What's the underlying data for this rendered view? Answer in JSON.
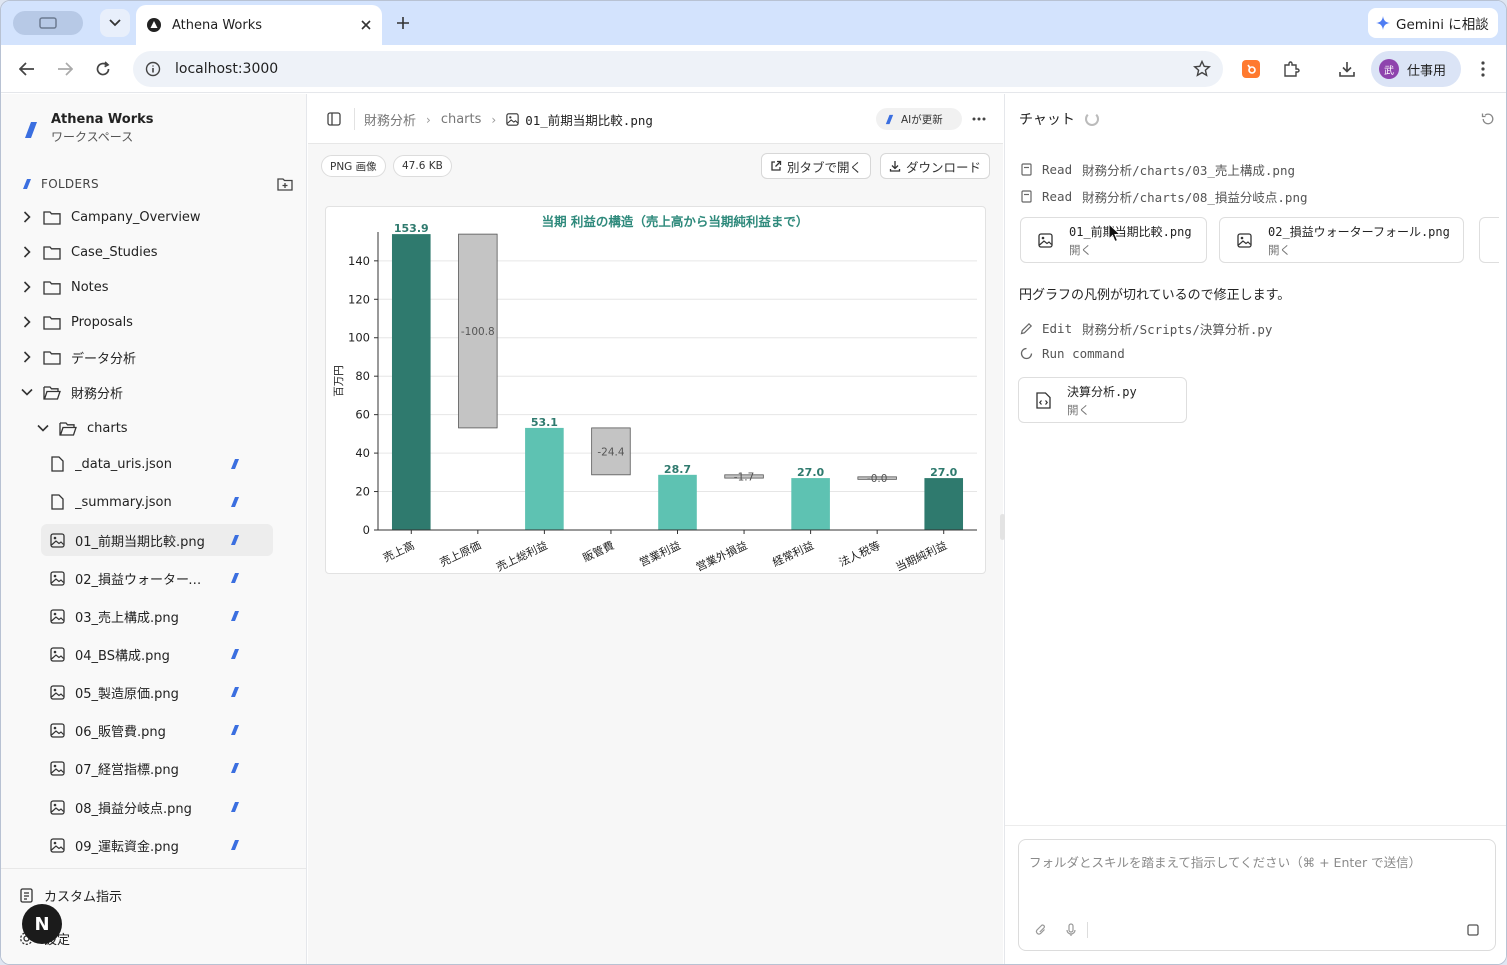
{
  "browser": {
    "tab_title": "Athena Works",
    "url": "localhost:3000",
    "gemini_label": "Gemini に相談",
    "profile_label": "仕事用",
    "profile_initial": "武"
  },
  "sidebar": {
    "brand_name": "Athena Works",
    "brand_sub": "ワークスペース",
    "folders_label": "FOLDERS",
    "folders": [
      {
        "label": "Campany_Overview"
      },
      {
        "label": "Case_Studies"
      },
      {
        "label": "Notes"
      },
      {
        "label": "Proposals"
      },
      {
        "label": "データ分析"
      },
      {
        "label": "財務分析"
      },
      {
        "label": "charts"
      }
    ],
    "files": [
      {
        "label": "_data_uris.json"
      },
      {
        "label": "_summary.json"
      },
      {
        "label": "01_前期当期比較.png"
      },
      {
        "label": "02_損益ウォーターフォール.png"
      },
      {
        "label": "03_売上構成.png"
      },
      {
        "label": "04_BS構成.png"
      },
      {
        "label": "05_製造原価.png"
      },
      {
        "label": "06_販管費.png"
      },
      {
        "label": "07_経営指標.png"
      },
      {
        "label": "08_損益分岐点.png"
      },
      {
        "label": "09_運転資金.png"
      }
    ],
    "custom_instructions": "カスタム指示",
    "settings": "設定",
    "badge": "N"
  },
  "viewer": {
    "breadcrumb": [
      "財務分析",
      "charts",
      "01_前期当期比較.png"
    ],
    "ai_updated": "AIが更新",
    "file_type": "PNG 画像",
    "file_size": "47.6 KB",
    "open_new_tab": "別タブで開く",
    "download": "ダウンロード"
  },
  "chart_data": {
    "type": "bar",
    "subtype": "waterfall",
    "title": "当期 利益の構造（売上高から当期純利益まで）",
    "ylabel": "百万円",
    "xlabel": "",
    "ylim": [
      0,
      155
    ],
    "yticks": [
      0,
      20,
      40,
      60,
      80,
      100,
      120,
      140
    ],
    "grid": true,
    "categories": [
      "売上高",
      "売上原価",
      "売上総利益",
      "販管費",
      "営業利益",
      "営業外損益",
      "経常利益",
      "法人税等",
      "当期純利益"
    ],
    "bars": [
      {
        "label": "153.9",
        "base": 0,
        "top": 153.9,
        "kind": "total"
      },
      {
        "label": "-100.8",
        "base": 53.1,
        "top": 153.9,
        "kind": "decrease"
      },
      {
        "label": "53.1",
        "base": 0,
        "top": 53.1,
        "kind": "subtotal"
      },
      {
        "label": "-24.4",
        "base": 28.7,
        "top": 53.1,
        "kind": "decrease"
      },
      {
        "label": "28.7",
        "base": 0,
        "top": 28.7,
        "kind": "subtotal"
      },
      {
        "label": "-1.7",
        "base": 27.0,
        "top": 28.7,
        "kind": "decrease"
      },
      {
        "label": "27.0",
        "base": 0,
        "top": 27.0,
        "kind": "subtotal"
      },
      {
        "label": "-0.0",
        "base": 27.0,
        "top": 27.0,
        "kind": "decrease"
      },
      {
        "label": "27.0",
        "base": 0,
        "top": 27.0,
        "kind": "total"
      }
    ],
    "colors": {
      "total": "#2f7a6e",
      "subtotal": "#5ec2b2",
      "decrease": "#c4c4c4",
      "title": "#2f8a7c"
    }
  },
  "chat": {
    "title": "チャット",
    "log": [
      {
        "verb": "Read",
        "path": "財務分析/charts/03_売上構成.png"
      },
      {
        "verb": "Read",
        "path": "財務分析/charts/08_損益分岐点.png"
      }
    ],
    "cards": [
      {
        "name": "01_前期当期比較.png",
        "sub": "開く"
      },
      {
        "name": "02_損益ウォーターフォール.png",
        "sub": "開く"
      }
    ],
    "message": "円グラフの凡例が切れているので修正します。",
    "actions": [
      {
        "verb": "Edit",
        "path": "財務分析/Scripts/決算分析.py"
      },
      {
        "verb": "Run command",
        "path": ""
      }
    ],
    "script_card": {
      "name": "決算分析.py",
      "sub": "開く"
    },
    "placeholder": "フォルダとスキルを踏まえて指示してください（⌘ + Enter で送信）"
  }
}
